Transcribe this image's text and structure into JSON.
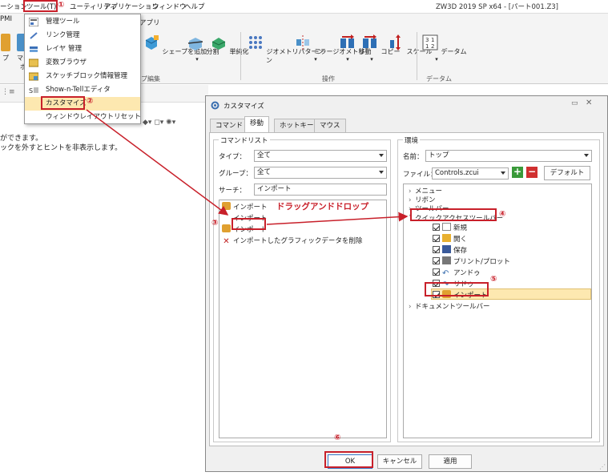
{
  "menubar": {
    "items": [
      "ーション",
      "ツール(T)",
      "ユーティリティ",
      "アプリケーション",
      "ウィンドウ",
      "ヘルプ"
    ],
    "title": "ZW3D 2019 SP x64 - [パート001.Z3]"
  },
  "ribbon": {
    "tab_pmi": "PMI",
    "tab_apps": "アプリ",
    "buttons": [
      "プ",
      "マー",
      "シェープを追加",
      "分割",
      "単純化",
      "ジオメトリパターン",
      "ミラージオメトリ",
      "移動",
      "コピー",
      "スケール",
      "データム"
    ],
    "button_continuations": [
      "ボ",
      "ン"
    ],
    "groups": [
      "プ編集",
      "操作",
      "データム"
    ]
  },
  "side_text": [
    "ができます。",
    "ックを外すとヒントを非表示します。"
  ],
  "tools_menu": {
    "items": [
      "管理ツール",
      "リンク管理",
      "レイヤ 管理",
      "変数ブラウザ",
      "スケッチブロック情報管理",
      "Show-n-Tellエディタ",
      "カスタマイズ",
      "ウィンドウレイアウトリセット"
    ],
    "highlighted_index": 6
  },
  "dialog": {
    "title": "カスタマイズ",
    "tabs": [
      "コマンド",
      "移動",
      "ホットキー",
      "マウス"
    ],
    "active_tab": "移動",
    "command_list": {
      "legend": "コマンドリスト",
      "type_label": "タイプ：",
      "type_value": "全て",
      "group_label": "グループ：",
      "group_value": "全て",
      "search_label": "サーチ：",
      "search_value": "インポート",
      "items": [
        "インポート",
        "インポート",
        "インポート",
        "インポートしたグラフィックデータを削除"
      ]
    },
    "environment": {
      "legend": "環境",
      "name_label": "名前：",
      "name_value": "トップ",
      "file_label": "ファイル：",
      "file_value": "Controls.zcui",
      "default_button": "デフォルト",
      "tree": [
        "メニュー",
        "リボン",
        "ツールバー",
        "クイックアクセスツールバー",
        "新規",
        "開く",
        "保存",
        "プリント/プロット",
        "アンドゥ",
        "リドゥ",
        "インポート",
        "ドキュメントツールバー"
      ]
    },
    "buttons": {
      "ok": "OK",
      "cancel": "キャンセル",
      "apply": "適用"
    }
  },
  "annotations": {
    "drag_drop": "ドラッグアンドドロップ",
    "steps": [
      "①",
      "②",
      "③",
      "④",
      "⑤",
      "⑥"
    ]
  },
  "colors": {
    "annotation_red": "#c8202a",
    "highlight": "#fde8b0",
    "ribbon_bg": "#f4f4f4"
  }
}
